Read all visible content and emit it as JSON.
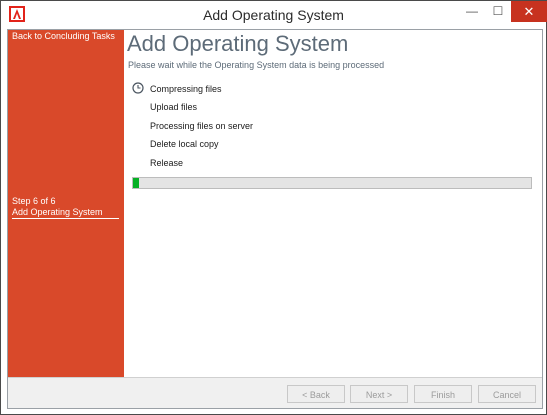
{
  "window": {
    "title": "Add Operating System",
    "controls": {
      "minimize": "—",
      "maximize": "☐",
      "close": "✕"
    },
    "app_icon": "app-logo-icon",
    "accent_color": "#d9492a"
  },
  "sidebar": {
    "back_link": "Back to Concluding Tasks",
    "step_text": "Step 6 of 6",
    "step_name": "Add Operating System"
  },
  "main": {
    "title": "Add Operating System",
    "subtitle": "Please wait while the Operating System data is being processed",
    "tasks": [
      {
        "label": "Compressing files",
        "icon": "clock-icon"
      },
      {
        "label": "Upload files"
      },
      {
        "label": "Processing files on server"
      },
      {
        "label": "Delete local copy"
      },
      {
        "label": "Release"
      }
    ],
    "progress": {
      "value": 0.015,
      "color": "#06b025"
    }
  },
  "footer": {
    "back": "< Back",
    "next": "Next >",
    "finish": "Finish",
    "cancel": "Cancel"
  }
}
